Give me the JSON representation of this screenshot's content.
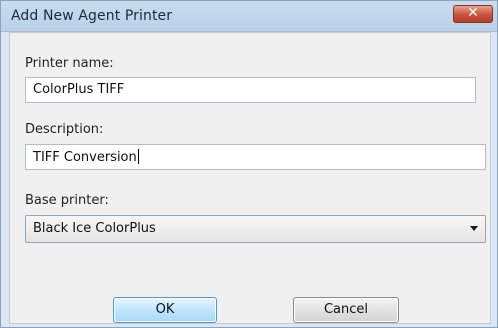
{
  "window": {
    "title": "Add New Agent Printer",
    "close_glyph": "✕"
  },
  "form": {
    "printer_name": {
      "label": "Printer name:",
      "value": "ColorPlus TIFF"
    },
    "description": {
      "label": "Description:",
      "value": "TIFF Conversion"
    },
    "base_printer": {
      "label": "Base printer:",
      "selected": "Black Ice ColorPlus"
    }
  },
  "buttons": {
    "ok_label": "OK",
    "cancel_label": "Cancel"
  },
  "colors": {
    "close_button": "#c9533a",
    "default_button_border": "#4a9bd3",
    "window_frame": "#dbe7f2"
  },
  "icons": {
    "close": "close-icon",
    "dropdown": "chevron-down-icon"
  }
}
